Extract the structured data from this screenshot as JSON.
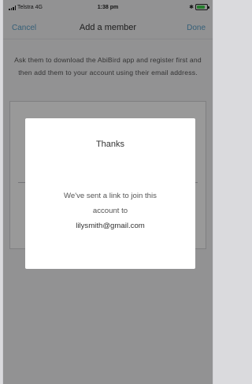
{
  "status_bar": {
    "carrier": "Telstra",
    "network": "4G",
    "time": "1:38 pm",
    "bluetooth_icon": "bluetooth-icon",
    "battery_level": 0.85,
    "battery_color": "#3ecf4c"
  },
  "nav": {
    "cancel_label": "Cancel",
    "title": "Add a member",
    "done_label": "Done",
    "accent": "#5aa0c8"
  },
  "instructions": "Ask them to download the AbiBird app and register first and then add them to your account using their email address.",
  "modal": {
    "title": "Thanks",
    "message_line1": "We've sent a link to join this",
    "message_line2": "account to",
    "email": "lilysmith@gmail.com"
  }
}
